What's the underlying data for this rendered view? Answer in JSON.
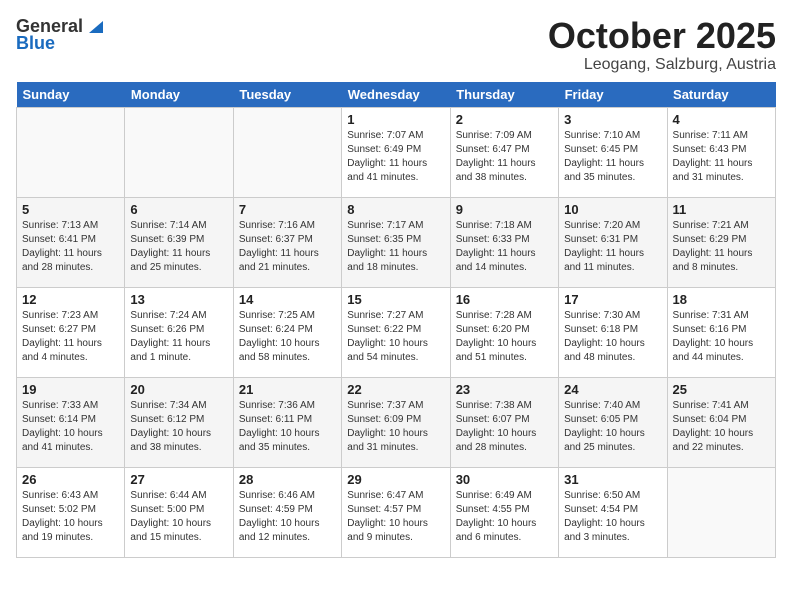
{
  "header": {
    "logo_general": "General",
    "logo_blue": "Blue",
    "month_title": "October 2025",
    "location": "Leogang, Salzburg, Austria"
  },
  "days_of_week": [
    "Sunday",
    "Monday",
    "Tuesday",
    "Wednesday",
    "Thursday",
    "Friday",
    "Saturday"
  ],
  "weeks": [
    [
      {
        "day": "",
        "sunrise": "",
        "sunset": "",
        "daylight": ""
      },
      {
        "day": "",
        "sunrise": "",
        "sunset": "",
        "daylight": ""
      },
      {
        "day": "",
        "sunrise": "",
        "sunset": "",
        "daylight": ""
      },
      {
        "day": "1",
        "sunrise": "Sunrise: 7:07 AM",
        "sunset": "Sunset: 6:49 PM",
        "daylight": "Daylight: 11 hours and 41 minutes."
      },
      {
        "day": "2",
        "sunrise": "Sunrise: 7:09 AM",
        "sunset": "Sunset: 6:47 PM",
        "daylight": "Daylight: 11 hours and 38 minutes."
      },
      {
        "day": "3",
        "sunrise": "Sunrise: 7:10 AM",
        "sunset": "Sunset: 6:45 PM",
        "daylight": "Daylight: 11 hours and 35 minutes."
      },
      {
        "day": "4",
        "sunrise": "Sunrise: 7:11 AM",
        "sunset": "Sunset: 6:43 PM",
        "daylight": "Daylight: 11 hours and 31 minutes."
      }
    ],
    [
      {
        "day": "5",
        "sunrise": "Sunrise: 7:13 AM",
        "sunset": "Sunset: 6:41 PM",
        "daylight": "Daylight: 11 hours and 28 minutes."
      },
      {
        "day": "6",
        "sunrise": "Sunrise: 7:14 AM",
        "sunset": "Sunset: 6:39 PM",
        "daylight": "Daylight: 11 hours and 25 minutes."
      },
      {
        "day": "7",
        "sunrise": "Sunrise: 7:16 AM",
        "sunset": "Sunset: 6:37 PM",
        "daylight": "Daylight: 11 hours and 21 minutes."
      },
      {
        "day": "8",
        "sunrise": "Sunrise: 7:17 AM",
        "sunset": "Sunset: 6:35 PM",
        "daylight": "Daylight: 11 hours and 18 minutes."
      },
      {
        "day": "9",
        "sunrise": "Sunrise: 7:18 AM",
        "sunset": "Sunset: 6:33 PM",
        "daylight": "Daylight: 11 hours and 14 minutes."
      },
      {
        "day": "10",
        "sunrise": "Sunrise: 7:20 AM",
        "sunset": "Sunset: 6:31 PM",
        "daylight": "Daylight: 11 hours and 11 minutes."
      },
      {
        "day": "11",
        "sunrise": "Sunrise: 7:21 AM",
        "sunset": "Sunset: 6:29 PM",
        "daylight": "Daylight: 11 hours and 8 minutes."
      }
    ],
    [
      {
        "day": "12",
        "sunrise": "Sunrise: 7:23 AM",
        "sunset": "Sunset: 6:27 PM",
        "daylight": "Daylight: 11 hours and 4 minutes."
      },
      {
        "day": "13",
        "sunrise": "Sunrise: 7:24 AM",
        "sunset": "Sunset: 6:26 PM",
        "daylight": "Daylight: 11 hours and 1 minute."
      },
      {
        "day": "14",
        "sunrise": "Sunrise: 7:25 AM",
        "sunset": "Sunset: 6:24 PM",
        "daylight": "Daylight: 10 hours and 58 minutes."
      },
      {
        "day": "15",
        "sunrise": "Sunrise: 7:27 AM",
        "sunset": "Sunset: 6:22 PM",
        "daylight": "Daylight: 10 hours and 54 minutes."
      },
      {
        "day": "16",
        "sunrise": "Sunrise: 7:28 AM",
        "sunset": "Sunset: 6:20 PM",
        "daylight": "Daylight: 10 hours and 51 minutes."
      },
      {
        "day": "17",
        "sunrise": "Sunrise: 7:30 AM",
        "sunset": "Sunset: 6:18 PM",
        "daylight": "Daylight: 10 hours and 48 minutes."
      },
      {
        "day": "18",
        "sunrise": "Sunrise: 7:31 AM",
        "sunset": "Sunset: 6:16 PM",
        "daylight": "Daylight: 10 hours and 44 minutes."
      }
    ],
    [
      {
        "day": "19",
        "sunrise": "Sunrise: 7:33 AM",
        "sunset": "Sunset: 6:14 PM",
        "daylight": "Daylight: 10 hours and 41 minutes."
      },
      {
        "day": "20",
        "sunrise": "Sunrise: 7:34 AM",
        "sunset": "Sunset: 6:12 PM",
        "daylight": "Daylight: 10 hours and 38 minutes."
      },
      {
        "day": "21",
        "sunrise": "Sunrise: 7:36 AM",
        "sunset": "Sunset: 6:11 PM",
        "daylight": "Daylight: 10 hours and 35 minutes."
      },
      {
        "day": "22",
        "sunrise": "Sunrise: 7:37 AM",
        "sunset": "Sunset: 6:09 PM",
        "daylight": "Daylight: 10 hours and 31 minutes."
      },
      {
        "day": "23",
        "sunrise": "Sunrise: 7:38 AM",
        "sunset": "Sunset: 6:07 PM",
        "daylight": "Daylight: 10 hours and 28 minutes."
      },
      {
        "day": "24",
        "sunrise": "Sunrise: 7:40 AM",
        "sunset": "Sunset: 6:05 PM",
        "daylight": "Daylight: 10 hours and 25 minutes."
      },
      {
        "day": "25",
        "sunrise": "Sunrise: 7:41 AM",
        "sunset": "Sunset: 6:04 PM",
        "daylight": "Daylight: 10 hours and 22 minutes."
      }
    ],
    [
      {
        "day": "26",
        "sunrise": "Sunrise: 6:43 AM",
        "sunset": "Sunset: 5:02 PM",
        "daylight": "Daylight: 10 hours and 19 minutes."
      },
      {
        "day": "27",
        "sunrise": "Sunrise: 6:44 AM",
        "sunset": "Sunset: 5:00 PM",
        "daylight": "Daylight: 10 hours and 15 minutes."
      },
      {
        "day": "28",
        "sunrise": "Sunrise: 6:46 AM",
        "sunset": "Sunset: 4:59 PM",
        "daylight": "Daylight: 10 hours and 12 minutes."
      },
      {
        "day": "29",
        "sunrise": "Sunrise: 6:47 AM",
        "sunset": "Sunset: 4:57 PM",
        "daylight": "Daylight: 10 hours and 9 minutes."
      },
      {
        "day": "30",
        "sunrise": "Sunrise: 6:49 AM",
        "sunset": "Sunset: 4:55 PM",
        "daylight": "Daylight: 10 hours and 6 minutes."
      },
      {
        "day": "31",
        "sunrise": "Sunrise: 6:50 AM",
        "sunset": "Sunset: 4:54 PM",
        "daylight": "Daylight: 10 hours and 3 minutes."
      },
      {
        "day": "",
        "sunrise": "",
        "sunset": "",
        "daylight": ""
      }
    ]
  ]
}
